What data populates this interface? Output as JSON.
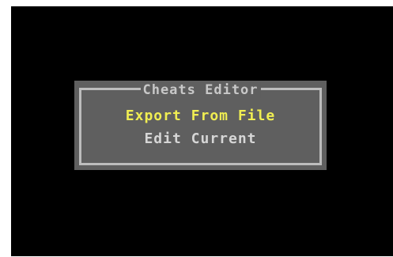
{
  "dialog": {
    "title": "Cheats Editor",
    "items": [
      {
        "label": "Export From File",
        "selected": true
      },
      {
        "label": "Edit Current",
        "selected": false
      }
    ]
  },
  "colors": {
    "background": "#000000",
    "dialog": "#5f5f5f",
    "border": "#bdbdbd",
    "selected_text": "#f0ee52",
    "normal_text": "#d6d6d6"
  }
}
